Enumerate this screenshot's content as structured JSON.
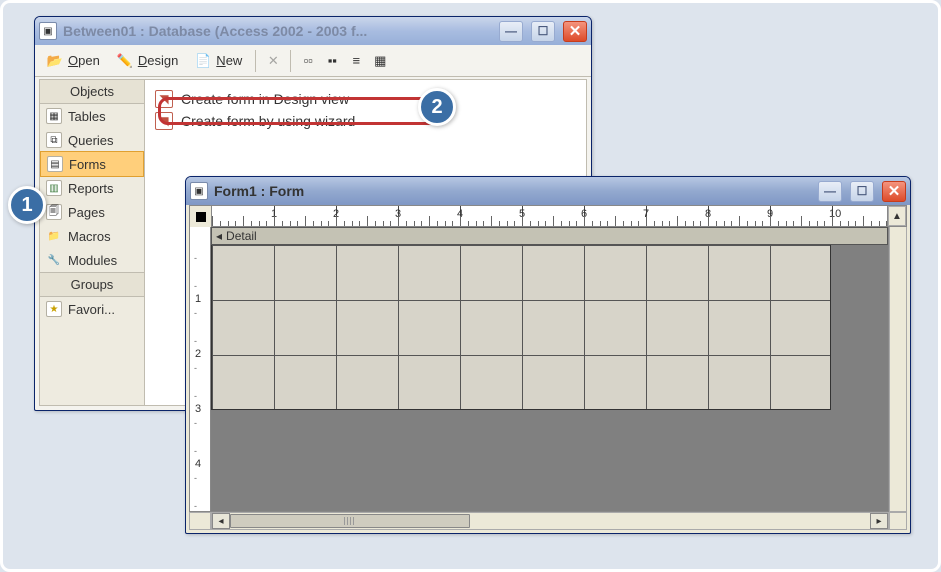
{
  "db_window": {
    "title": "Between01 : Database (Access 2002 - 2003 f...",
    "toolbar": {
      "open": "Open",
      "design": "Design",
      "new": "New"
    },
    "nav": {
      "objects_header": "Objects",
      "groups_header": "Groups",
      "items": [
        {
          "label": "Tables",
          "icon": "📊"
        },
        {
          "label": "Queries",
          "icon": "🔍"
        },
        {
          "label": "Forms",
          "icon": "📋"
        },
        {
          "label": "Reports",
          "icon": "📄"
        },
        {
          "label": "Pages",
          "icon": "📃"
        },
        {
          "label": "Macros",
          "icon": "📁"
        },
        {
          "label": "Modules",
          "icon": "⚙"
        }
      ],
      "favorites": "Favori..."
    },
    "list": {
      "items": [
        {
          "label": "Create form in Design view"
        },
        {
          "label": "Create form by using wizard"
        }
      ]
    }
  },
  "form_window": {
    "title": "Form1 : Form",
    "section": "Detail",
    "ruler_max": 11,
    "vruler_max": 4
  },
  "callouts": {
    "c1": "1",
    "c2": "2"
  },
  "colors": {
    "highlight": "#c23434",
    "callout": "#3b6ea5",
    "selected_nav": "#ffcf7b"
  }
}
